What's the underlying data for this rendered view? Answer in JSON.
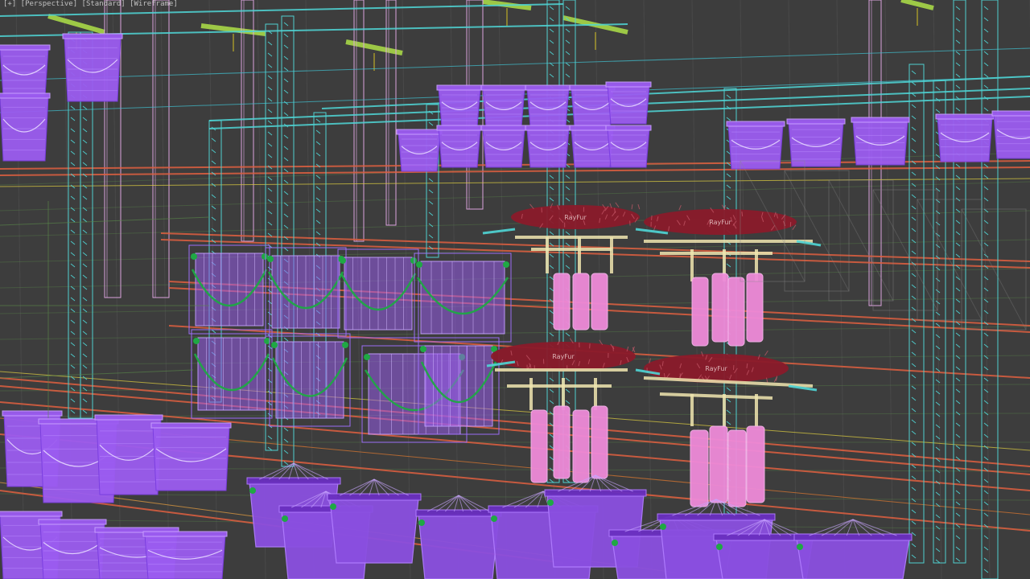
{
  "viewport": {
    "label": "[+] [Perspective] [Standard] [Wireframe]",
    "background": "#3d3d3d"
  },
  "scene": {
    "fur_label": "RayFur",
    "colors": {
      "bucket": "#9b5cf0",
      "bucket_stroke": "#7a3ee0",
      "rack_upright": "#4fd6d6",
      "shelf_beam": "#e06040",
      "hanging_bag": "#ee8ad8",
      "fur": "#8a1a2a",
      "pipe": "#f0e6b0",
      "handle": "#1fa844",
      "pillar": "#e3a8e6",
      "light": "#a8d848",
      "guide_line": "#5a8a4a"
    }
  }
}
